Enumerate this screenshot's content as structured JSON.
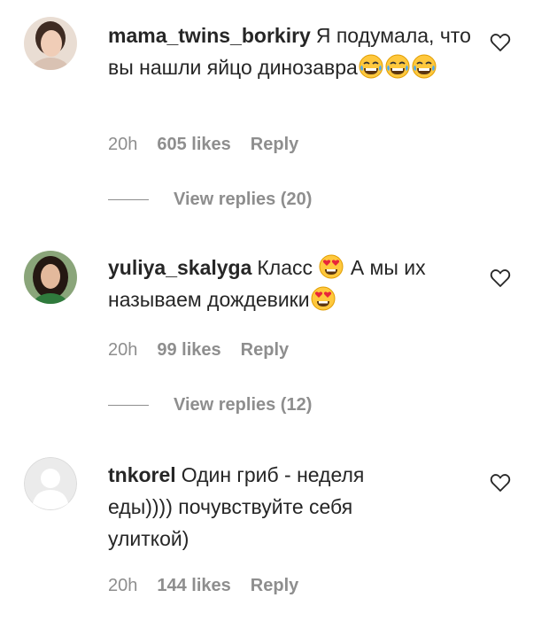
{
  "comments": [
    {
      "username": "mama_twins_borkiry",
      "text": "Я подумала, что вы нашли яйцо динозавра",
      "emoji": "😂😂😂",
      "time": "20h",
      "likes": "605 likes",
      "reply": "Reply",
      "view_replies": "View replies (20)",
      "avatar": "woman-portrait"
    },
    {
      "username": "yuliya_skalyga",
      "text_before": "Класс",
      "emoji_mid": "😍",
      "text_after": "А мы их называем дождевики",
      "emoji_end": "😍",
      "time": "20h",
      "likes": "99 likes",
      "reply": "Reply",
      "view_replies": "View replies (12)",
      "avatar": "woman-dark-hair"
    },
    {
      "username": "tnkorel",
      "text": "Один гриб - неделя еды)))) почувствуйте себя улиткой)",
      "time": "20h",
      "likes": "144 likes",
      "reply": "Reply",
      "avatar": "default-avatar"
    }
  ],
  "colors": {
    "text": "#262626",
    "secondary": "#8e8e8e",
    "background": "#ffffff"
  },
  "icons": {
    "like": "heart-outline-icon",
    "laugh": "tears-of-joy-emoji",
    "love": "heart-eyes-emoji"
  }
}
